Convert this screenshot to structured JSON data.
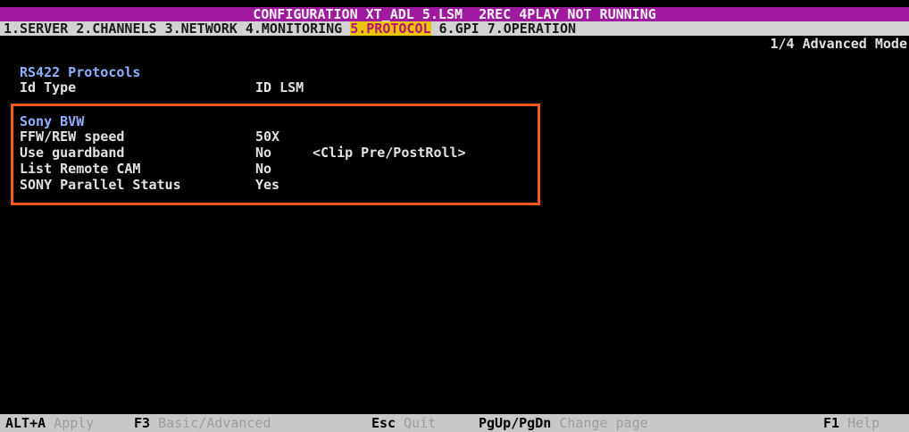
{
  "title": "CONFIGURATION XT_ADL 5.LSM  2REC 4PLAY NOT RUNNING",
  "menu": {
    "items": [
      {
        "label": "1.SERVER"
      },
      {
        "label": "2.CHANNELS"
      },
      {
        "label": "3.NETWORK"
      },
      {
        "label": "4.MONITORING"
      },
      {
        "label": "5.PROTOCOL",
        "active": true
      },
      {
        "label": "6.GPI"
      },
      {
        "label": "7.OPERATION"
      }
    ]
  },
  "mode_label": "1/4 Advanced Mode",
  "rs422": {
    "title": "RS422 Protocols",
    "id_type": {
      "label": "Id Type",
      "value": "ID LSM"
    }
  },
  "sony_bvw": {
    "title": "Sony BVW",
    "rows": [
      {
        "label": "FFW/REW speed",
        "value": "50X"
      },
      {
        "label": "Use guardband",
        "value": "No",
        "note": "<Clip Pre/PostRoll>"
      },
      {
        "label": "List Remote CAM",
        "value": "No"
      },
      {
        "label": "SONY Parallel Status",
        "value": "Yes"
      }
    ]
  },
  "status_bar": {
    "items": [
      {
        "key": "ALT+A",
        "desc": "Apply"
      },
      {
        "key": "F3",
        "desc": "Basic/Advanced"
      },
      {
        "key": "Esc",
        "desc": "Quit"
      },
      {
        "key": "PgUp/PgDn",
        "desc": "Change page"
      },
      {
        "key": "F1",
        "desc": "Help"
      }
    ]
  },
  "colors": {
    "title_bar_bg": "#a01aa0",
    "menu_bar_bg": "#d2d2d2",
    "active_tab_bg": "#e8c700",
    "active_tab_fg": "#b8127a",
    "section_title": "#8fb0ff",
    "highlight_border": "#ff5a1a",
    "screen_bg": "#000000"
  }
}
